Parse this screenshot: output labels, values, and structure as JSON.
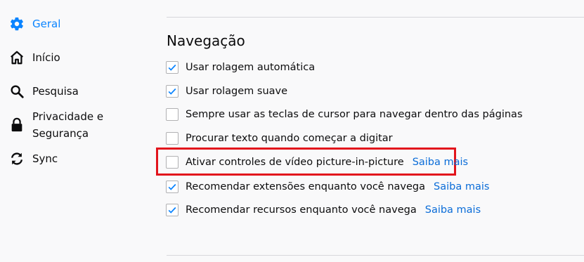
{
  "sidebar": {
    "items": [
      {
        "label": "Geral",
        "icon": "gear-icon",
        "selected": true
      },
      {
        "label": "Início",
        "icon": "home-icon",
        "selected": false
      },
      {
        "label": "Pesquisa",
        "icon": "search-icon",
        "selected": false
      },
      {
        "label_line1": "Privacidade e",
        "label_line2": "Segurança",
        "icon": "lock-icon",
        "selected": false
      },
      {
        "label": "Sync",
        "icon": "sync-icon",
        "selected": false
      }
    ]
  },
  "main": {
    "section_title": "Navegação",
    "options": [
      {
        "label": "Usar rolagem automática",
        "checked": true
      },
      {
        "label": "Usar rolagem suave",
        "checked": true
      },
      {
        "label": "Sempre usar as teclas de cursor para navegar dentro das páginas",
        "checked": false
      },
      {
        "label": "Procurar texto quando começar a digitar",
        "checked": false
      },
      {
        "label": "Ativar controles de vídeo picture-in-picture",
        "checked": false,
        "link": "Saiba mais",
        "highlighted": true
      },
      {
        "label": "Recomendar extensões enquanto você navega",
        "checked": true,
        "link": "Saiba mais"
      },
      {
        "label": "Recomendar recursos enquanto você navega",
        "checked": true,
        "link": "Saiba mais"
      }
    ]
  },
  "colors": {
    "accent": "#0a84ff",
    "link": "#0a6cd8",
    "highlight": "#e2141c",
    "background": "#f9f9fa"
  }
}
